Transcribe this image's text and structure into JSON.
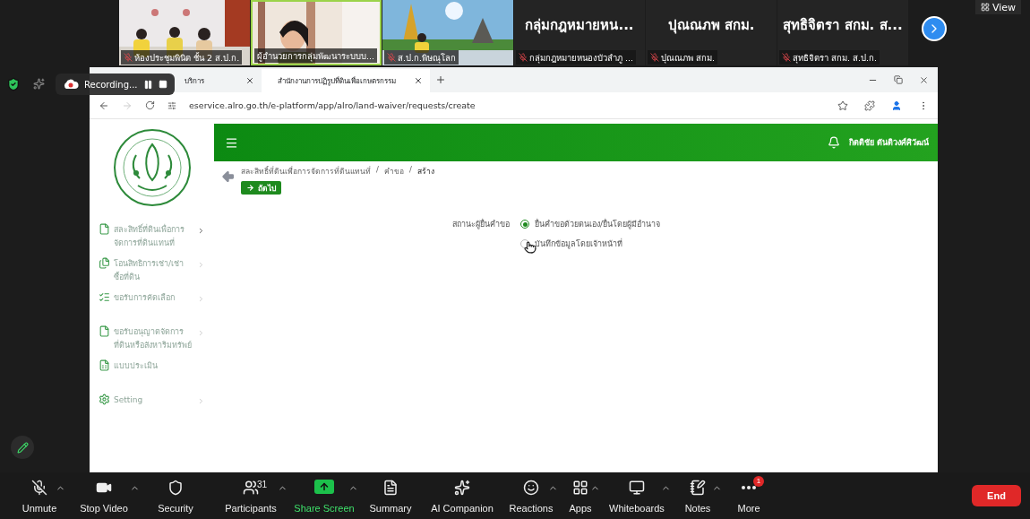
{
  "meeting": {
    "view_button": "View",
    "participants": [
      {
        "kind": "video",
        "name": "ห้องประชุมพินิต ชั้น 2 ส.ป.ก.",
        "muted": true,
        "speaking": false
      },
      {
        "kind": "video",
        "name": "ผู้อำนวยการกลุ่มพัฒนาระบบบ...",
        "muted": false,
        "speaking": true
      },
      {
        "kind": "video",
        "name": "ส.ป.ก.พิษณุโลก",
        "muted": true,
        "speaking": false
      },
      {
        "kind": "name",
        "display": "กลุ่มกฎหมายหน...",
        "name": "กลุ่มกฎหมายหนองบัวลำภู ...",
        "muted": true,
        "speaking": false
      },
      {
        "kind": "name",
        "display": "ปุณณภพ สกม.",
        "name": "ปุณณภพ สกม.",
        "muted": true,
        "speaking": false
      },
      {
        "kind": "name",
        "display": "สุทธิจิตรา สกม. ส...",
        "name": "สุทธิจิตรา สกม. ส.ป.ก.",
        "muted": true,
        "speaking": false
      }
    ],
    "recording": {
      "label": "Recording..."
    }
  },
  "browser": {
    "tabs": [
      {
        "title": "บริการ",
        "selected": false
      },
      {
        "title": "สำนักงานการปฏิรูปที่ดินเพื่อเกษตรกรรม",
        "selected": true
      }
    ],
    "url": "eservice.alro.go.th/e-platform/app/alro/land-waiver/requests/create"
  },
  "app": {
    "user": "กิตติชัย ตันติวงศ์ศิวัฒน์",
    "sidebar": [
      {
        "kind": "file",
        "label": "สละสิทธิ์ที่ดินเพื่อการจัดการที่ดินแทนที่",
        "has_submenu": true
      },
      {
        "kind": "files",
        "label": "โอนสิทธิการเช่า/เช่าซื้อที่ดิน",
        "has_submenu": true
      },
      {
        "kind": "list",
        "label": "ขอรับการคัดเลือก",
        "has_submenu": true
      },
      {
        "kind": "file",
        "label": "ขอรับอนุญาตจัดการที่ดินหรือสังหาริมทรัพย์",
        "has_submenu": true
      },
      {
        "kind": "sheet",
        "label": "แบบประเมิน",
        "has_submenu": false
      },
      {
        "kind": "settings",
        "label": "Setting",
        "has_submenu": true
      }
    ],
    "breadcrumb_separator": "/",
    "breadcrumb": [
      "สละสิทธิ์ที่ดินเพื่อการจัดการที่ดินแทนที่",
      "คำขอ",
      "สร้าง"
    ],
    "next_button": "ถัดไป",
    "applicant_status": {
      "label": "สถานะผู้ยื่นคำขอ",
      "options": [
        {
          "label": "ยื่นคำขอด้วยตนเอง/ยื่นโดยผู้มีอำนาจ",
          "selected": true
        },
        {
          "label": "บันทึกข้อมูลโดยเจ้าหน้าที่",
          "selected": false
        }
      ]
    }
  },
  "toolbar": {
    "items": [
      {
        "kind": "mic",
        "label": "Unmute",
        "has_menu": true
      },
      {
        "kind": "video",
        "label": "Stop Video",
        "has_menu": true
      },
      {
        "kind": "security",
        "label": "Security",
        "has_menu": false
      },
      {
        "kind": "participants",
        "label": "Participants",
        "count": "31",
        "has_menu": true
      },
      {
        "kind": "share",
        "label": "Share Screen",
        "has_menu": true
      },
      {
        "kind": "summary",
        "label": "Summary",
        "has_menu": false
      },
      {
        "kind": "ai",
        "label": "AI Companion",
        "has_menu": false
      },
      {
        "kind": "reactions",
        "label": "Reactions",
        "has_menu": true
      },
      {
        "kind": "apps",
        "label": "Apps",
        "has_menu": true
      },
      {
        "kind": "whiteboards",
        "label": "Whiteboards",
        "has_menu": true
      },
      {
        "kind": "notes",
        "label": "Notes",
        "has_menu": true
      },
      {
        "kind": "more",
        "label": "More",
        "badge": "1",
        "has_menu": false
      }
    ],
    "end_button": "End"
  }
}
